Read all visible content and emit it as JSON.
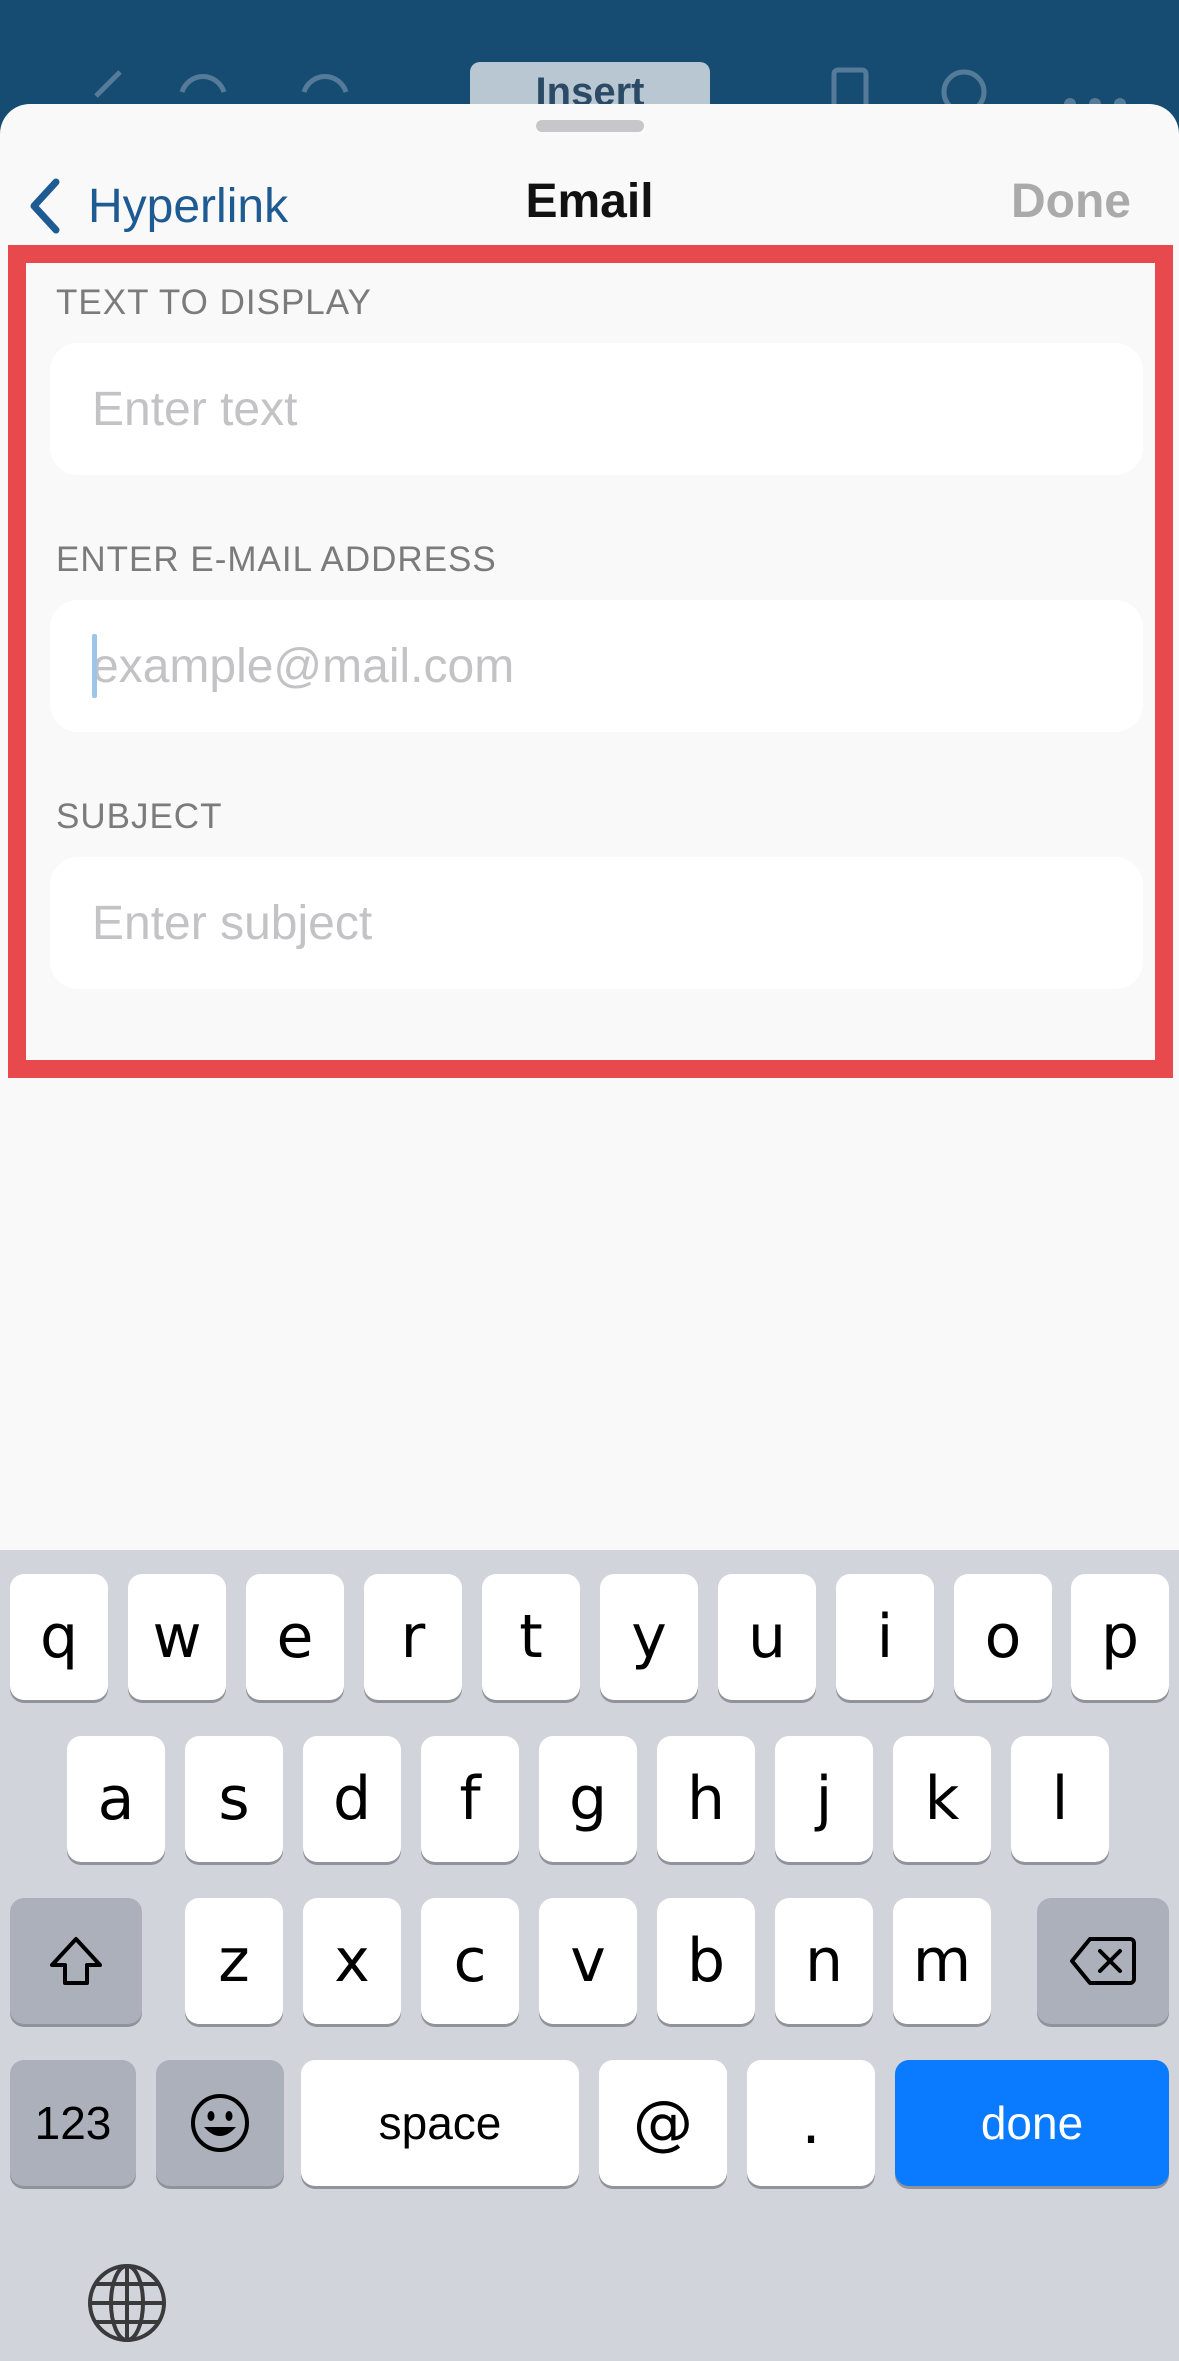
{
  "toolbar": {
    "insert_label": "Insert",
    "icons": [
      "back-arrow-icon",
      "undo-icon",
      "redo-icon",
      "phone-view-icon",
      "search-icon",
      "more-icon"
    ]
  },
  "nav": {
    "back_label": "Hyperlink",
    "title": "Email",
    "done_label": "Done"
  },
  "form": {
    "text_label": "TEXT TO DISPLAY",
    "text_placeholder": "Enter text",
    "email_label": "ENTER E-MAIL ADDRESS",
    "email_placeholder": "example@mail.com",
    "subject_label": "SUBJECT",
    "subject_placeholder": "Enter subject"
  },
  "keyboard": {
    "row1": [
      "q",
      "w",
      "e",
      "r",
      "t",
      "y",
      "u",
      "i",
      "o",
      "p"
    ],
    "row2": [
      "a",
      "s",
      "d",
      "f",
      "g",
      "h",
      "j",
      "k",
      "l"
    ],
    "row3": [
      "z",
      "x",
      "c",
      "v",
      "b",
      "n",
      "m"
    ],
    "numbers_label": "123",
    "space_label": "space",
    "at_label": "@",
    "dot_label": ".",
    "done_label": "done"
  },
  "colors": {
    "accent": "#0a7aff",
    "link": "#1e5b92",
    "highlight_border": "#e8494d",
    "toolbar_bg": "#174c72"
  }
}
